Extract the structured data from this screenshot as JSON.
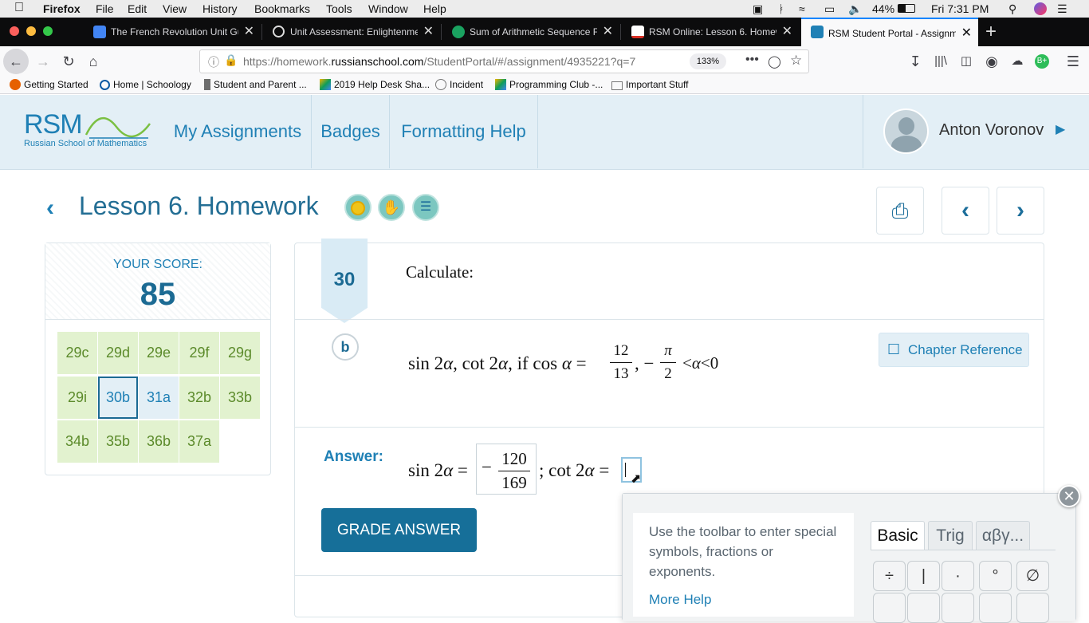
{
  "menubar": {
    "app": "Firefox",
    "items": [
      "File",
      "Edit",
      "View",
      "History",
      "Bookmarks",
      "Tools",
      "Window",
      "Help"
    ],
    "battery": "44%",
    "clock": "Fri 7:31 PM"
  },
  "tabs": [
    {
      "title": "The French Revolution Unit Gui",
      "color": "#4285f4"
    },
    {
      "title": "Unit Assessment: Enlightenmen",
      "color": "#ffffff"
    },
    {
      "title": "Sum of Arithmetic Sequence Fo",
      "color": "#1aa260"
    },
    {
      "title": "RSM Online: Lesson 6. Homewo",
      "color": "#d93025"
    },
    {
      "title": "RSM Student Portal - Assignme",
      "color": "#1f80b5"
    }
  ],
  "nav": {
    "url_prefix": "https://homework.",
    "url_domain": "russianschool.com",
    "url_path": "/StudentPortal/#/assignment/4935221?q=7",
    "zoom": "133%"
  },
  "bookmarks": [
    {
      "label": "Getting Started",
      "color": "#e66000"
    },
    {
      "label": "Home | Schoology",
      "color": "#0a5aa4"
    },
    {
      "label": "Student and Parent ...",
      "color": "#6d6d6d"
    },
    {
      "label": "2019 Help Desk Sha...",
      "color": "#f4b400"
    },
    {
      "label": "Incident",
      "color": "#999999"
    },
    {
      "label": "Programming Club -...",
      "color": "#f4b400"
    },
    {
      "label": "Important Stuff",
      "color": "#777777"
    }
  ],
  "header": {
    "logo_text": "RSM",
    "logo_sub": "Russian School of Mathematics",
    "nav": [
      "My Assignments",
      "Badges",
      "Formatting Help"
    ],
    "user": "Anton Voronov"
  },
  "lesson": {
    "title": "Lesson 6. Homework"
  },
  "score": {
    "label": "YOUR SCORE:",
    "value": "85",
    "problems": [
      "29c",
      "29d",
      "29e",
      "29f",
      "29g",
      "29i",
      "30b",
      "31a",
      "32b",
      "33b",
      "34b",
      "35b",
      "36b",
      "37a"
    ],
    "selected": "30b"
  },
  "question": {
    "number": "30",
    "prompt": "Calculate:",
    "part": "b",
    "chapter_ref": "Chapter Reference",
    "answer_label": "Answer:",
    "grade_button": "GRADE ANSWER"
  },
  "math_help": {
    "text": "Use the toolbar to enter special symbols, fractions or exponents.",
    "more_help": "More Help",
    "tabs": [
      "Basic",
      "Trig",
      "αβγ..."
    ],
    "keys": [
      "÷",
      "|",
      "·",
      "°",
      "∅"
    ]
  }
}
